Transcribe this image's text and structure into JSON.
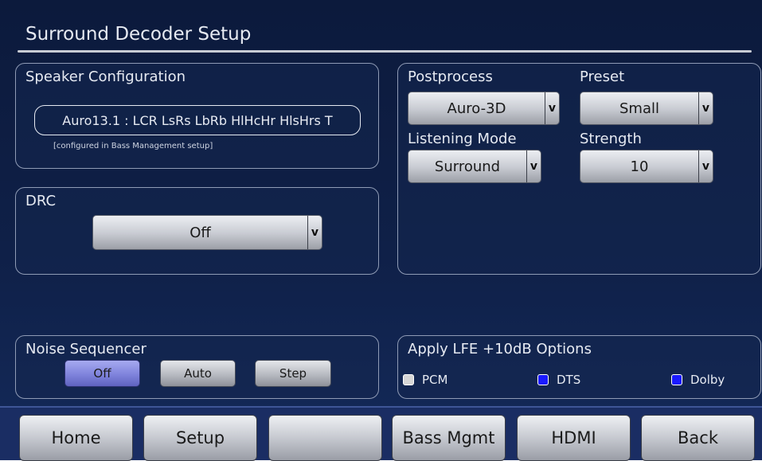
{
  "header": {
    "title": "Surround Decoder Setup"
  },
  "speaker_config": {
    "title": "Speaker Configuration",
    "value": "Auro13.1 : LCR LsRs LbRb HlHcHr HlsHrs T",
    "note": "[configured in Bass Management setup]"
  },
  "drc": {
    "title": "DRC",
    "value": "Off",
    "arrow": "v"
  },
  "postprocess": {
    "postprocess_label": "Postprocess",
    "postprocess_value": "Auro-3D",
    "preset_label": "Preset",
    "preset_value": "Small",
    "listening_label": "Listening Mode",
    "listening_value": "Surround",
    "strength_label": "Strength",
    "strength_value": "10",
    "arrow": "v"
  },
  "noise_sequencer": {
    "title": "Noise Sequencer",
    "options": [
      "Off",
      "Auto",
      "Step"
    ],
    "selected": "Off"
  },
  "lfe": {
    "title": "Apply LFE +10dB Options",
    "options": [
      {
        "label": "PCM",
        "color": "#d6d6d6",
        "checked": false
      },
      {
        "label": "DTS",
        "color": "#1a1aff",
        "checked": true
      },
      {
        "label": "Dolby",
        "color": "#1a1aff",
        "checked": true
      }
    ]
  },
  "nav": {
    "home": "Home",
    "setup": "Setup",
    "blank": "",
    "bass": "Bass Mgmt",
    "hdmi": "HDMI",
    "back": "Back"
  },
  "colors": {
    "background": "#0f2048",
    "active_button": "#7f83dc",
    "checkbox_checked": "#1a1aff",
    "checkbox_unchecked": "#d6d6d6"
  }
}
